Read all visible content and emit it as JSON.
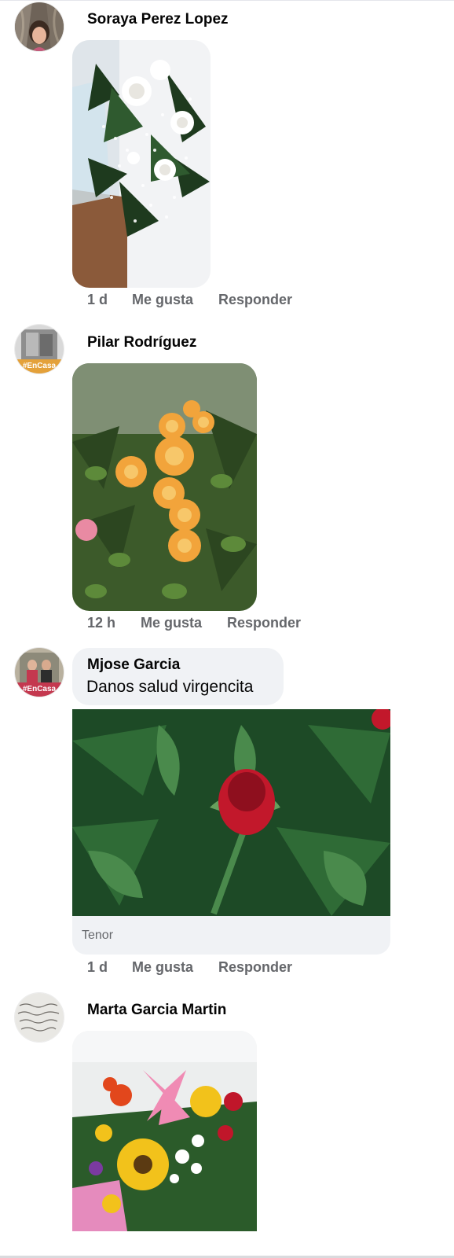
{
  "comments": [
    {
      "author": "Soraya Perez Lopez",
      "time": "1 d",
      "like_label": "Me gusta",
      "reply_label": "Responder",
      "avatar_icon": "profile-photo",
      "media": "photo-white-roses-bouquet"
    },
    {
      "author": "Pilar Rodríguez",
      "time": "12 h",
      "like_label": "Me gusta",
      "reply_label": "Responder",
      "avatar_icon": "profile-photo-frame",
      "media": "photo-orange-roses-bush"
    },
    {
      "author": "Mjose Garcia",
      "text": "Danos salud virgencita",
      "gif_provider": "Tenor",
      "time": "1 d",
      "like_label": "Me gusta",
      "reply_label": "Responder",
      "avatar_icon": "profile-photo-frame",
      "media": "gif-red-rose-bud"
    },
    {
      "author": "Marta Garcia Martin",
      "avatar_icon": "profile-handwritten-quote",
      "media": "photo-mixed-flower-bouquet"
    }
  ],
  "colors": {
    "name_text": "#050505",
    "meta_text": "#65676b",
    "bubble_bg": "#f0f2f5"
  }
}
